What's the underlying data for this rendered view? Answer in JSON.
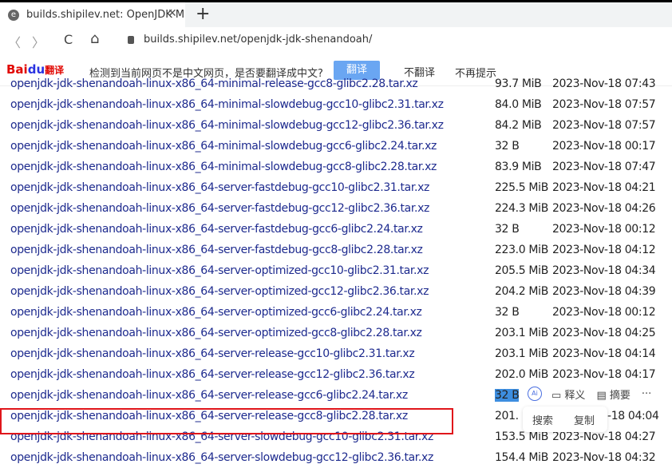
{
  "tab": {
    "title": "builds.shipilev.net: OpenJDK M",
    "close": "✕",
    "new": "+"
  },
  "nav": {
    "back": "〈",
    "forward": "〉",
    "reload": "C",
    "home": "⌂",
    "url": "builds.shipilev.net/openjdk-jdk-shenandoah/"
  },
  "translate": {
    "logo_a": "Bai",
    "logo_b": "du",
    "logo_c": "翻译",
    "message": "检测到当前网页不是中文网页，是否要翻译成中文?",
    "translate_btn": "翻译",
    "no_translate": "不翻译",
    "never": "不再提示"
  },
  "files": [
    {
      "name": "openjdk-jdk-shenandoah-linux-x86_64-minimal-release-gcc8-glibc2.28.tar.xz",
      "size": "93.7 MiB",
      "date": "2023-Nov-18 07:43"
    },
    {
      "name": "openjdk-jdk-shenandoah-linux-x86_64-minimal-slowdebug-gcc10-glibc2.31.tar.xz",
      "size": "84.0 MiB",
      "date": "2023-Nov-18 07:57"
    },
    {
      "name": "openjdk-jdk-shenandoah-linux-x86_64-minimal-slowdebug-gcc12-glibc2.36.tar.xz",
      "size": "84.2 MiB",
      "date": "2023-Nov-18 07:57"
    },
    {
      "name": "openjdk-jdk-shenandoah-linux-x86_64-minimal-slowdebug-gcc6-glibc2.24.tar.xz",
      "size": "32 B",
      "date": "2023-Nov-18 00:17"
    },
    {
      "name": "openjdk-jdk-shenandoah-linux-x86_64-minimal-slowdebug-gcc8-glibc2.28.tar.xz",
      "size": "83.9 MiB",
      "date": "2023-Nov-18 07:47"
    },
    {
      "name": "openjdk-jdk-shenandoah-linux-x86_64-server-fastdebug-gcc10-glibc2.31.tar.xz",
      "size": "225.5 MiB",
      "date": "2023-Nov-18 04:21"
    },
    {
      "name": "openjdk-jdk-shenandoah-linux-x86_64-server-fastdebug-gcc12-glibc2.36.tar.xz",
      "size": "224.3 MiB",
      "date": "2023-Nov-18 04:26"
    },
    {
      "name": "openjdk-jdk-shenandoah-linux-x86_64-server-fastdebug-gcc6-glibc2.24.tar.xz",
      "size": "32 B",
      "date": "2023-Nov-18 00:12"
    },
    {
      "name": "openjdk-jdk-shenandoah-linux-x86_64-server-fastdebug-gcc8-glibc2.28.tar.xz",
      "size": "223.0 MiB",
      "date": "2023-Nov-18 04:12"
    },
    {
      "name": "openjdk-jdk-shenandoah-linux-x86_64-server-optimized-gcc10-glibc2.31.tar.xz",
      "size": "205.5 MiB",
      "date": "2023-Nov-18 04:34"
    },
    {
      "name": "openjdk-jdk-shenandoah-linux-x86_64-server-optimized-gcc12-glibc2.36.tar.xz",
      "size": "204.2 MiB",
      "date": "2023-Nov-18 04:39"
    },
    {
      "name": "openjdk-jdk-shenandoah-linux-x86_64-server-optimized-gcc6-glibc2.24.tar.xz",
      "size": "32 B",
      "date": "2023-Nov-18 00:12"
    },
    {
      "name": "openjdk-jdk-shenandoah-linux-x86_64-server-optimized-gcc8-glibc2.28.tar.xz",
      "size": "203.1 MiB",
      "date": "2023-Nov-18 04:25"
    },
    {
      "name": "openjdk-jdk-shenandoah-linux-x86_64-server-release-gcc10-glibc2.31.tar.xz",
      "size": "203.1 MiB",
      "date": "2023-Nov-18 04:14"
    },
    {
      "name": "openjdk-jdk-shenandoah-linux-x86_64-server-release-gcc12-glibc2.36.tar.xz",
      "size": "202.0 MiB",
      "date": "2023-Nov-18 04:17"
    },
    {
      "name": "openjdk-jdk-shenandoah-linux-x86_64-server-release-gcc6-glibc2.24.tar.xz",
      "size": "32 B",
      "date": ""
    },
    {
      "name": "openjdk-jdk-shenandoah-linux-x86_64-server-release-gcc8-glibc2.28.tar.xz",
      "size": "201.",
      "date": "-18 04:04"
    },
    {
      "name": "openjdk-jdk-shenandoah-linux-x86_64-server-slowdebug-gcc10-glibc2.31.tar.xz",
      "size": "153.5 MiB",
      "date": "2023-Nov-18 04:27"
    },
    {
      "name": "openjdk-jdk-shenandoah-linux-x86_64-server-slowdebug-gcc12-glibc2.36.tar.xz",
      "size": "154.4 MiB",
      "date": "2023-Nov-18 04:32"
    }
  ],
  "selection_popup": {
    "ai": "Ai",
    "define": "释义",
    "summary": "摘要",
    "more": "···",
    "search": "搜索",
    "copy": "复制"
  },
  "colors": {
    "link": "#1d2a8e",
    "highlight_box": "#e0161b",
    "selection": "#3d8ee0"
  }
}
